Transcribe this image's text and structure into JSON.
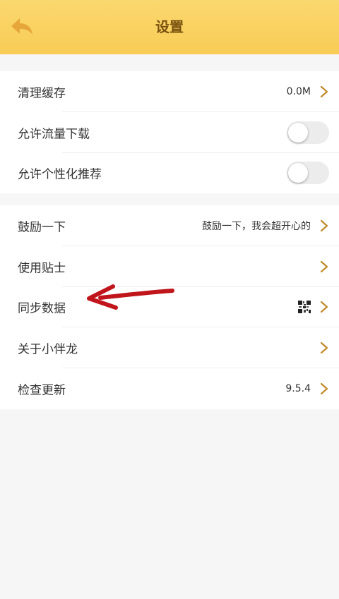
{
  "header": {
    "title": "设置",
    "back_icon": "back-arrow-icon"
  },
  "colors": {
    "header_bg": "#f8cc55",
    "title_color": "#7a5210",
    "chevron_color": "#c08a2a",
    "arrow_color": "#c0151b"
  },
  "section1": {
    "clear_cache": {
      "label": "清理缓存",
      "value": "0.0M"
    },
    "allow_data_download": {
      "label": "允许流量下载",
      "toggle_on": false
    },
    "personalized_recommend": {
      "label": "允许个性化推荐",
      "toggle_on": false
    }
  },
  "section2": {
    "encourage": {
      "label": "鼓励一下",
      "value": "鼓励一下，我会超开心的"
    },
    "tips": {
      "label": "使用贴士"
    },
    "sync_data": {
      "label": "同步数据",
      "icon": "qr-code-icon"
    },
    "about": {
      "label": "关于小伴龙"
    },
    "check_update": {
      "label": "检查更新",
      "value": "9.5.4"
    }
  },
  "annotation": {
    "icon": "red-arrow-annotation"
  }
}
